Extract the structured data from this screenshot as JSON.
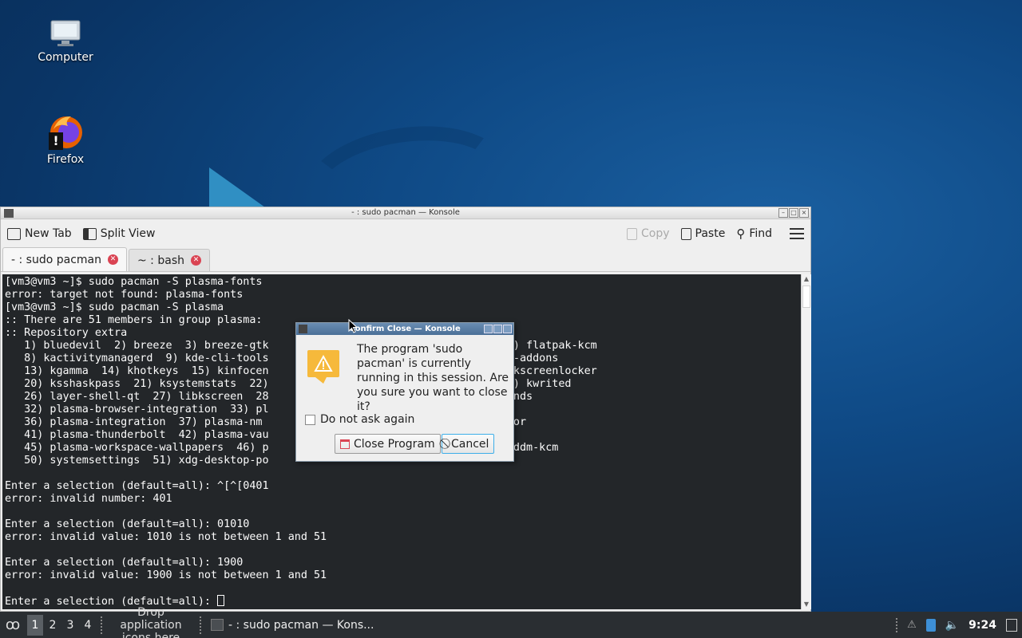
{
  "desktop": {
    "icons": [
      {
        "label": "Computer"
      },
      {
        "label": "Firefox"
      }
    ]
  },
  "window": {
    "title": "- : sudo pacman — Konsole",
    "toolbar": {
      "new_tab": "New Tab",
      "split_view": "Split View",
      "copy": "Copy",
      "paste": "Paste",
      "find": "Find"
    },
    "tabs": [
      {
        "label": "- : sudo pacman",
        "active": true
      },
      {
        "label": "~ : bash",
        "active": false
      }
    ],
    "terminal_text": "[vm3@vm3 ~]$ sudo pacman -S plasma-fonts\nerror: target not found: plasma-fonts\n[vm3@vm3 ~]$ sudo pacman -S plasma\n:: There are 51 members in group plasma:\n:: Repository extra\n   1) bluedevil  2) breeze  3) breeze-gtk                    ver  6) drkonqi  7) flatpak-kcm\n   8) kactivitymanagerd  9) kde-cli-tools                oration  12) kdeplasma-addons\n   13) kgamma  14) khotkeys  15) kinfocen                ire  18) kscreen  19) kscreenlocker\n   20) ksshaskpass  21) ksystemstats  22)                egration  24) kwin  25) kwrited\n   26) layer-shell-qt  27) libkscreen  28                oxygen  31) oxygen-sounds\n   32) plasma-browser-integration  33) pl                35) plasma-firewall\n   36) plasma-integration  37) plasma-nm                 40) plasma-systemmonitor\n   41) plasma-thunderbolt  42) plasma-vau            asma-workspace\n   45) plasma-workspace-wallpapers  46) p            ent  48) powerdevil  49) sddm-kcm\n   50) systemsettings  51) xdg-desktop-po\n\nEnter a selection (default=all): ^[^[0401\nerror: invalid number: 401\n\nEnter a selection (default=all): 01010\nerror: invalid value: 1010 is not between 1 and 51\n\nEnter a selection (default=all): 1900\nerror: invalid value: 1900 is not between 1 and 51\n\nEnter a selection (default=all): "
  },
  "dialog": {
    "title": "Confirm Close — Konsole",
    "message": "The program 'sudo pacman' is currently running in this session.  Are you sure you want to close it?",
    "checkbox_label": "Do not ask again",
    "close_button": "Close Program",
    "cancel_button": "Cancel"
  },
  "taskbar": {
    "desktops": [
      "1",
      "2",
      "3",
      "4"
    ],
    "drop_text": "Drop application icons here",
    "task_label": "- : sudo pacman — Kons...",
    "clock": "9:24"
  },
  "colors": {
    "terminal_bg": "#232629",
    "close_badge": "#da4453",
    "accent": "#3daee9",
    "warning": "#f6b93b"
  }
}
